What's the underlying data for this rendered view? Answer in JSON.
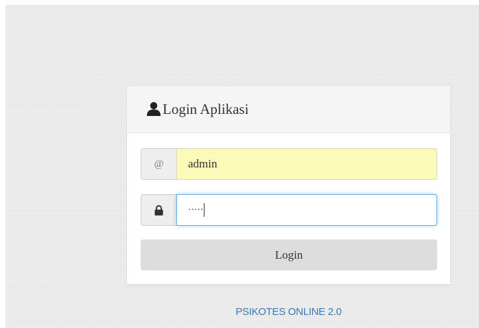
{
  "login_panel": {
    "title": "Login Aplikasi",
    "title_icon": "user-icon"
  },
  "username": {
    "addon_symbol": "@",
    "value": "admin"
  },
  "password": {
    "addon_icon": "lock-icon",
    "masked_value": "·····"
  },
  "login_button": {
    "label": "Login"
  },
  "footer": {
    "app_name": "PSIKOTES ONLINE 2.0"
  },
  "colors": {
    "autofill_background": "#fbfbb7",
    "focus_border": "#66afe9",
    "link": "#3a78b5",
    "button": "#dddddd"
  }
}
